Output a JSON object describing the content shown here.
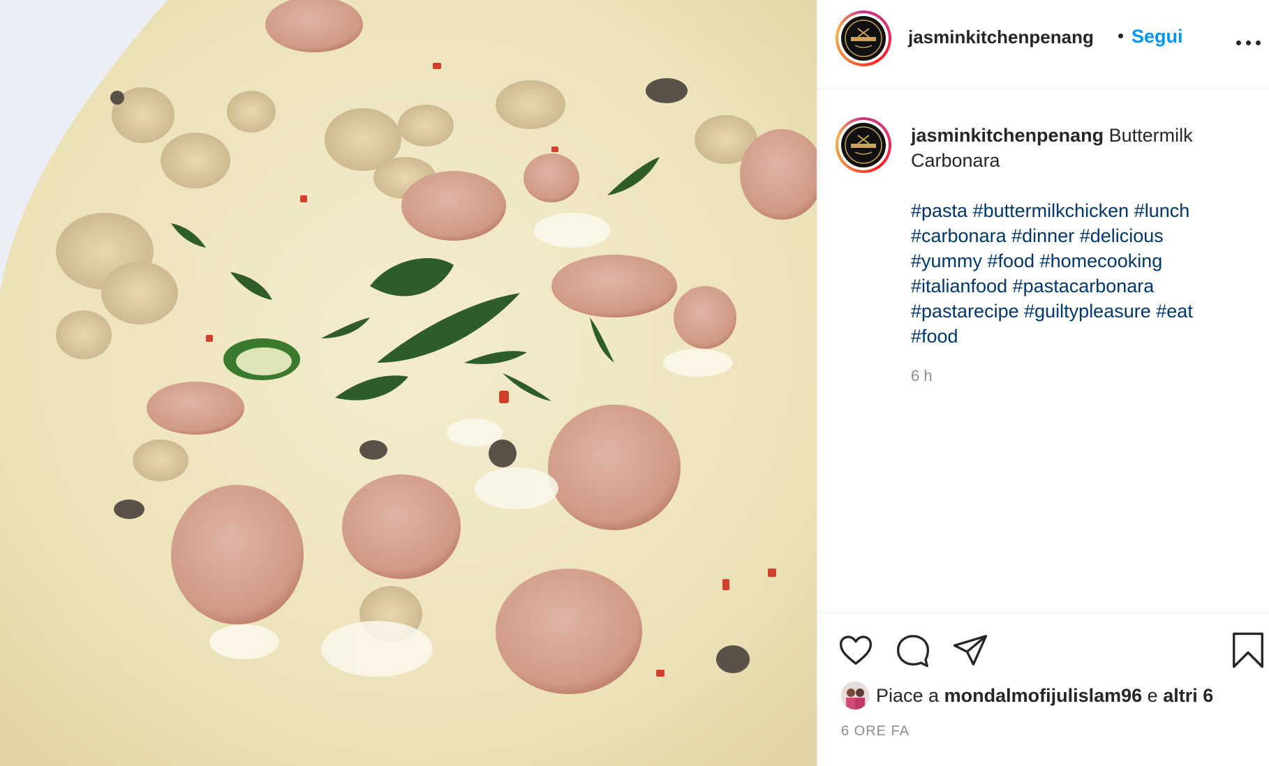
{
  "post": {
    "username": "jasminkitchenpenang",
    "follow_label": "Segui",
    "separator": "•",
    "logo_text": "JASMIN KITCHEN",
    "caption_text": "Buttermilk Carbonara",
    "hashtags": [
      "#pasta",
      "#buttermilkchicken",
      "#lunch",
      "#carbonara",
      "#dinner",
      "#delicious",
      "#yummy",
      "#food",
      "#homecooking",
      "#italianfood",
      "#pastacarbonara",
      "#pastarecipe",
      "#guiltypleasure",
      "#eat",
      "#food"
    ],
    "caption_time": "6 h",
    "likes_prefix": "Piace a",
    "liked_by": "mondalmofijulislam96",
    "likes_conj": "e",
    "likes_others": "altri 6",
    "post_time": "6 ORE FA"
  },
  "icons": {
    "like": "heart-icon",
    "comment": "comment-icon",
    "share": "paper-plane-icon",
    "save": "bookmark-icon",
    "more": "more-options-icon"
  },
  "colors": {
    "follow_blue": "#0095f6",
    "hashtag_blue": "#00376b",
    "text": "#262626",
    "muted": "#8e8e8e",
    "sauce": "#efe6c0"
  }
}
